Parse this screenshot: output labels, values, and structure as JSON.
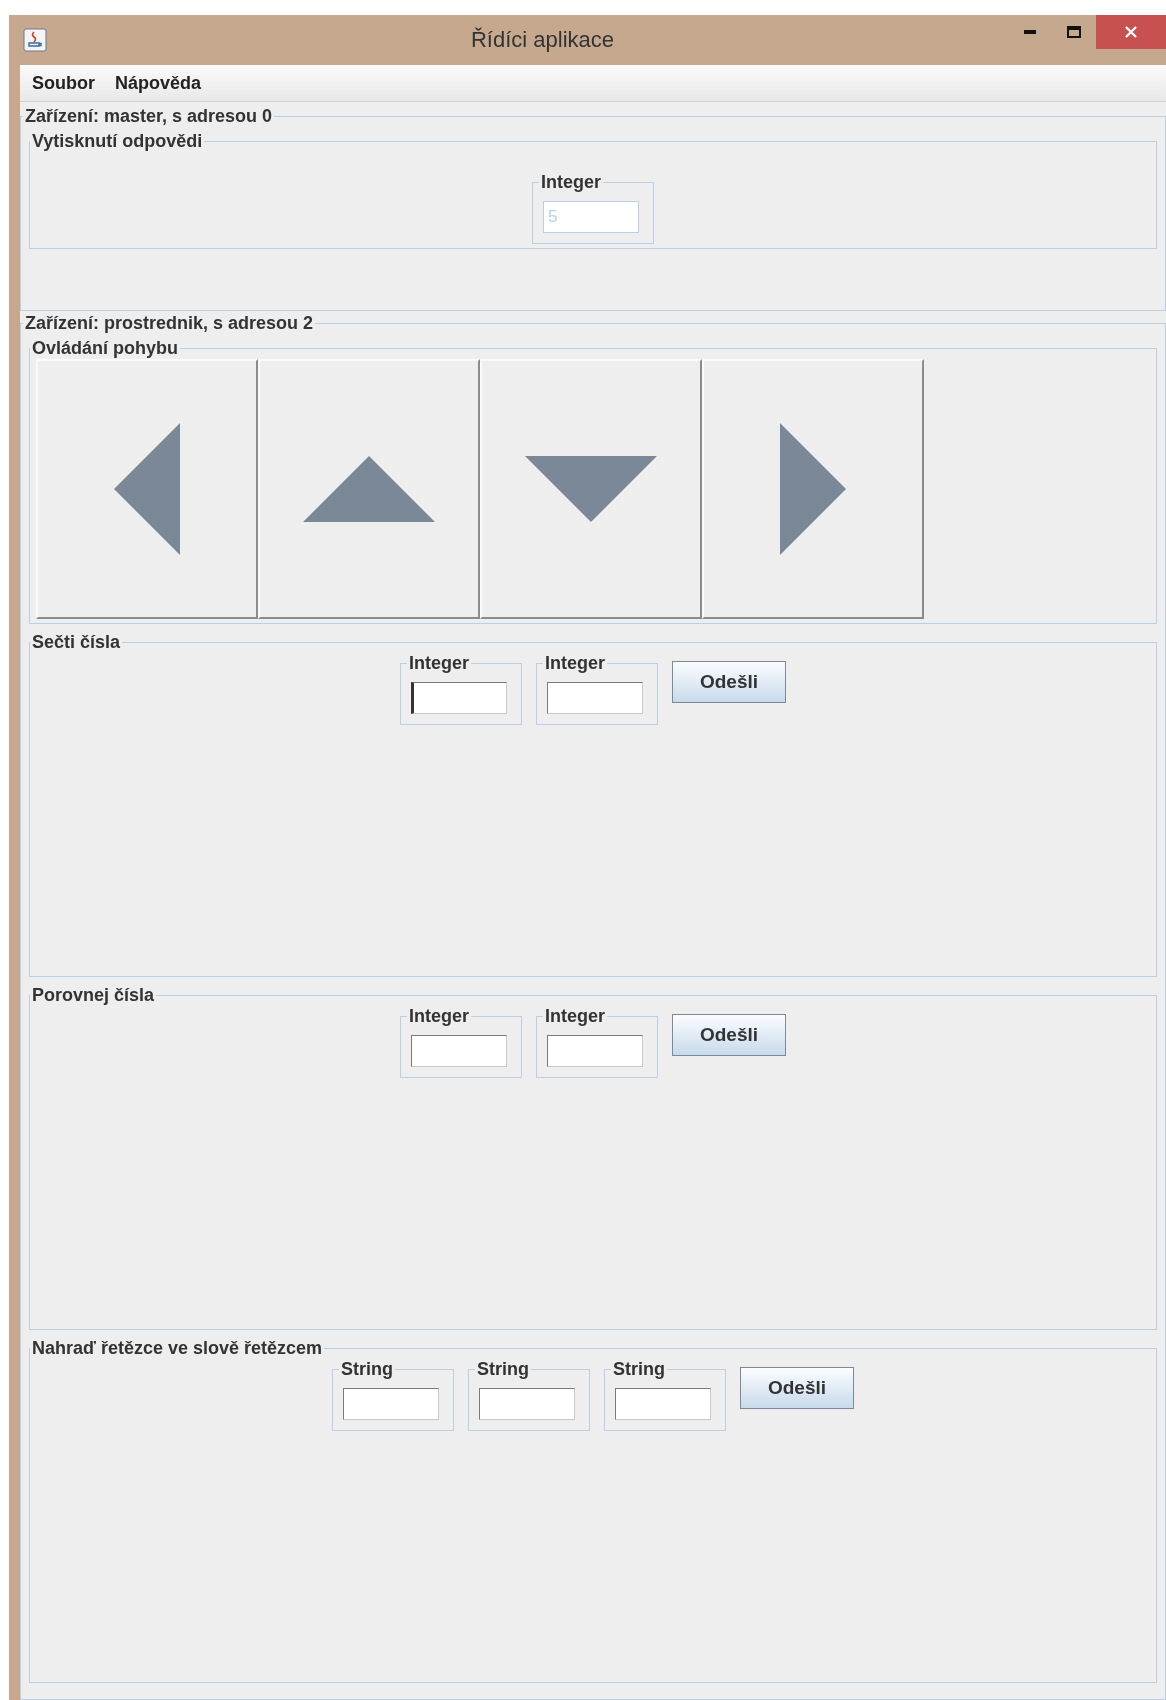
{
  "window": {
    "title": "Řídíci aplikace"
  },
  "menu": [
    {
      "label": "Soubor"
    },
    {
      "label": "Nápověda"
    }
  ],
  "devices": [
    {
      "title": "Zařízení: master, s adresou 0",
      "panels": [
        {
          "kind": "inputs",
          "title": "Vytisknutí odpovědi",
          "fields": [
            {
              "label": "Integer",
              "value": "5",
              "disabled": true,
              "focused": false
            }
          ]
        }
      ]
    },
    {
      "title": "Zařízení: prostrednik, s adresou 2",
      "panels": [
        {
          "kind": "arrows",
          "title": "Ovládání pohybu",
          "buttons": [
            {
              "kind": "left"
            },
            {
              "kind": "up"
            },
            {
              "kind": "down"
            },
            {
              "kind": "right"
            }
          ]
        },
        {
          "kind": "inputs",
          "title": "Sečti čísla",
          "fields": [
            {
              "label": "Integer",
              "disabled": false,
              "focused": true
            },
            {
              "label": "Integer",
              "disabled": false,
              "focused": false
            }
          ],
          "button": "Odešli"
        },
        {
          "kind": "inputs",
          "title": "Porovnej čísla",
          "fields": [
            {
              "label": "Integer",
              "disabled": false,
              "focused": false
            },
            {
              "label": "Integer",
              "disabled": false,
              "focused": false
            }
          ],
          "button": "Odešli"
        },
        {
          "kind": "inputs",
          "title": "Nahraď řetězce ve slově řetězcem",
          "fields": [
            {
              "label": "String",
              "disabled": false,
              "focused": false
            },
            {
              "label": "String",
              "disabled": false,
              "focused": false
            },
            {
              "label": "String",
              "disabled": false,
              "focused": false
            }
          ],
          "button": "Odešli"
        }
      ]
    }
  ]
}
